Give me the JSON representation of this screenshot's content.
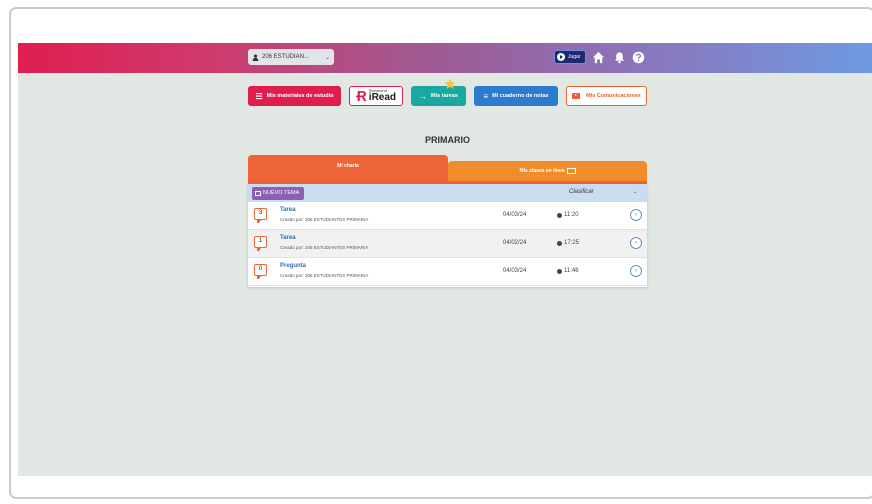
{
  "header": {
    "user_select": "206 ESTUDIAN...",
    "jugar_label": "Jugar"
  },
  "nav": {
    "materiales": "Mis materiales de estudio",
    "iread_small": "Richmond",
    "iread_big": "iRead",
    "tareas": "Mis tareas",
    "cuaderno": "Mi cuaderno de notas",
    "comunicaciones": "Mis Comunicaciones"
  },
  "page": {
    "title": "PRIMARIO"
  },
  "tabs": {
    "charla": "Mi charla",
    "clases": "Mis clases en línea"
  },
  "toolbar": {
    "nuevo_tema": "NUEVO TEMA",
    "clasificar": "Clasificar"
  },
  "rows": [
    {
      "count": "3",
      "title": "Tarea",
      "sub": "Creado por: 206 ESTUDIANTES PRIMARIA",
      "date": "04/03/24",
      "time": "11:20"
    },
    {
      "count": "1",
      "title": "Tarea",
      "sub": "Creado por: 206 ESTUDIANTES PRIMARIA",
      "date": "04/02/24",
      "time": "17:25"
    },
    {
      "count": "0",
      "title": "Pregunta",
      "sub": "Creado por: 206 ESTUDIANTES PRIMARIA",
      "date": "04/03/24",
      "time": "11:46"
    }
  ],
  "colors": {
    "accent_red": "#de1f4e",
    "accent_orange": "#ed6436",
    "teal": "#1aa9a0",
    "blue": "#2c7bcf"
  },
  "icons": [
    "user-icon",
    "chevron-down-icon",
    "play-icon",
    "home-icon",
    "bell-icon",
    "help-icon",
    "star-icon",
    "list-icon",
    "arrow-right-icon",
    "checklist-icon",
    "chat-icon",
    "clock-icon",
    "chevron-right-icon"
  ]
}
